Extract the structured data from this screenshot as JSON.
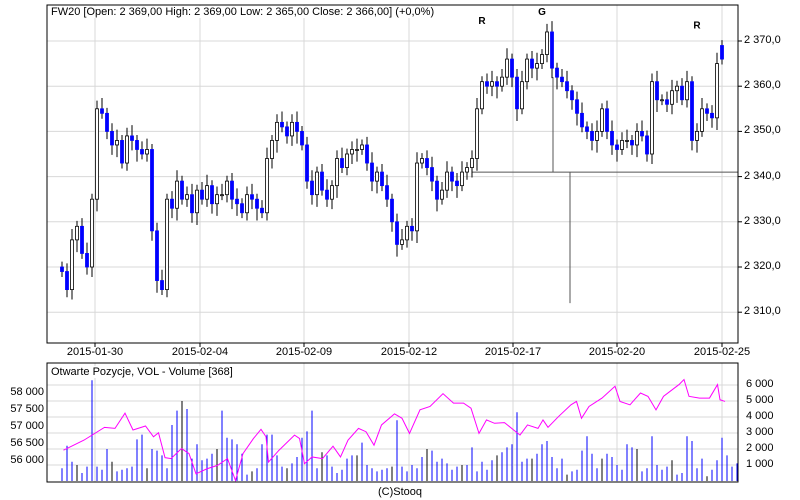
{
  "header": {
    "title": "FW20 [Open: 2 369,00  High: 2 369,00  Low: 2 365,00  Close: 2 366,00] (+0,0%)"
  },
  "volume_panel": {
    "title": "Otwarte Pozycje, VOL - Volume [368]"
  },
  "footer": {
    "credit": "(C)Stooq"
  },
  "colors": {
    "down": "#0000ff",
    "up": "#ffffff",
    "outline": "#000000",
    "oi_line": "#ff00ff",
    "grid": "#d8d8d8",
    "volume": "#0000ff"
  },
  "chart_data": [
    {
      "type": "candlestick",
      "title": "FW20",
      "ylim": [
        2308,
        2373
      ],
      "y_ticks": [
        "2 310,0",
        "2 320,0",
        "2 330,0",
        "2 340,0",
        "2 350,0",
        "2 360,0",
        "2 370,0"
      ],
      "y_tick_values": [
        2310,
        2320,
        2330,
        2340,
        2350,
        2360,
        2370
      ],
      "x_ticks": [
        "2015-01-30",
        "2015-02-04",
        "2015-02-09",
        "2015-02-12",
        "2015-02-17",
        "2015-02-20",
        "2015-02-25"
      ],
      "x_tick_bar_index": [
        6.6,
        27.6,
        48.4,
        69.4,
        90.2,
        111,
        132
      ],
      "grid": true,
      "closes": [
        2319,
        2315,
        2326,
        2329,
        2323,
        2320,
        2335,
        2355,
        2354,
        2350,
        2347,
        2348,
        2343,
        2349,
        2348,
        2346,
        2345,
        2346,
        2328,
        2317,
        2315,
        2335,
        2333,
        2339,
        2335,
        2336,
        2332,
        2337,
        2335,
        2338,
        2334,
        2336,
        2336,
        2339,
        2335,
        2334,
        2332,
        2336,
        2335,
        2333,
        2332,
        2344,
        2348,
        2352,
        2351,
        2349,
        2352,
        2350,
        2347,
        2339,
        2336,
        2341,
        2337,
        2335,
        2338,
        2344,
        2342,
        2345,
        2346,
        2346,
        2347,
        2343,
        2339,
        2341,
        2338,
        2335,
        2330,
        2325,
        2326,
        2329,
        2328,
        2343,
        2344,
        2342,
        2339,
        2335,
        2337,
        2341,
        2339,
        2338,
        2341,
        2342,
        2344,
        2355,
        2361,
        2360,
        2361,
        2360,
        2362,
        2366,
        2362,
        2355,
        2361,
        2366,
        2364,
        2365,
        2367,
        2372,
        2364,
        2362,
        2361,
        2359,
        2357,
        2354,
        2351,
        2350,
        2348,
        2350,
        2355,
        2350,
        2347,
        2346,
        2348,
        2348,
        2347,
        2350,
        2349,
        2345,
        2361,
        2357,
        2357,
        2356,
        2359,
        2360,
        2357,
        2361,
        2348,
        2350,
        2355,
        2354,
        2353,
        2365,
        2366
      ],
      "last_open": 2369,
      "annotations": [
        {
          "label": "R",
          "bar_index": 84,
          "price": 2372
        },
        {
          "label": "G",
          "bar_index": 96,
          "price": 2374
        },
        {
          "label": "R",
          "bar_index": 127,
          "price": 2371
        }
      ],
      "support_level": 2341,
      "support_from_bar_index": 82,
      "marker_lines": [
        {
          "bar_index": 98.2,
          "from": 2341,
          "to": 2362
        },
        {
          "bar_index": 101.6,
          "from": 2341,
          "to": 2312
        }
      ]
    },
    {
      "type": "bar+line",
      "title": "Otwarte Pozycje, VOL - Volume [368]",
      "volume_ylim": [
        0,
        6500
      ],
      "volume_ticks": [
        "1 000",
        "2 000",
        "3 000",
        "4 000",
        "5 000",
        "6 000"
      ],
      "volume_tick_values": [
        1000,
        2000,
        3000,
        4000,
        5000,
        6000
      ],
      "oi_ticks": [
        "56 000",
        "56 500",
        "57 000",
        "57 500",
        "58 000"
      ],
      "oi_tick_values": [
        56000,
        56500,
        57000,
        57500,
        58000
      ],
      "oi_ylim": [
        55400,
        58500
      ],
      "volume": [
        800,
        2200,
        1200,
        1000,
        500,
        900,
        6300,
        900,
        700,
        2000,
        1200,
        600,
        700,
        800,
        900,
        2600,
        2900,
        800,
        2000,
        1900,
        1600,
        800,
        3500,
        4400,
        5000,
        4500,
        1400,
        2300,
        1300,
        1400,
        1700,
        2000,
        4400,
        2700,
        2600,
        2300,
        1700,
        400,
        600,
        800,
        2300,
        2900,
        2900,
        1600,
        900,
        800,
        1100,
        1500,
        2700,
        3100,
        4400,
        800,
        1800,
        1600,
        900,
        500,
        700,
        1400,
        1600,
        1600,
        2400,
        1000,
        800,
        600,
        700,
        800,
        900,
        3800,
        900,
        600,
        1000,
        800,
        1500,
        2000,
        1900,
        1200,
        1400,
        1100,
        700,
        900,
        1000,
        1000,
        2100,
        600,
        1200,
        700,
        1300,
        1600,
        1800,
        2100,
        2300,
        4300,
        1200,
        1400,
        1400,
        1700,
        2300,
        2500,
        1500,
        800,
        1400,
        400,
        600,
        700,
        1900,
        2800,
        1700,
        800,
        1400,
        1700,
        1500,
        1000,
        700,
        2300,
        2100,
        2000,
        600,
        800,
        2800,
        1000,
        700,
        900,
        1300,
        400,
        500,
        2800,
        2500,
        800,
        1400,
        300,
        700,
        1300,
        2700,
        1600,
        900,
        1100
      ],
      "open_interest": [
        [
          0.3,
          56317
        ],
        [
          4.4,
          56614
        ],
        [
          8.5,
          56990
        ],
        [
          10.6,
          56960
        ],
        [
          12.6,
          57406
        ],
        [
          14.2,
          56911
        ],
        [
          16.7,
          57030
        ],
        [
          18.3,
          56713
        ],
        [
          19.3,
          56832
        ],
        [
          20.6,
          56099
        ],
        [
          21.8,
          56070
        ],
        [
          23.9,
          56366
        ],
        [
          25.4,
          56218
        ],
        [
          26.8,
          55624
        ],
        [
          29,
          55772
        ],
        [
          31.1,
          55871
        ],
        [
          33.1,
          56070
        ],
        [
          34.7,
          55426
        ],
        [
          36.2,
          56218
        ],
        [
          38.3,
          56663
        ],
        [
          39.8,
          56931
        ],
        [
          40.8,
          56713
        ],
        [
          41.3,
          55970
        ],
        [
          43.4,
          56317
        ],
        [
          46.5,
          56762
        ],
        [
          47.5,
          56663
        ],
        [
          48.5,
          55921
        ],
        [
          50,
          56119
        ],
        [
          52.1,
          56070
        ],
        [
          54.2,
          56436
        ],
        [
          55.7,
          56119
        ],
        [
          57.2,
          56614
        ],
        [
          59.3,
          56960
        ],
        [
          60.8,
          56861
        ],
        [
          62.4,
          56465
        ],
        [
          63.9,
          57060
        ],
        [
          66.5,
          57386
        ],
        [
          68,
          57257
        ],
        [
          69.5,
          56812
        ],
        [
          71.6,
          57505
        ],
        [
          73.6,
          57604
        ],
        [
          76.2,
          57980
        ],
        [
          78.3,
          57703
        ],
        [
          80.3,
          57703
        ],
        [
          81.8,
          57554
        ],
        [
          83.4,
          56812
        ],
        [
          84.9,
          57208
        ],
        [
          86.5,
          57109
        ],
        [
          88.5,
          57129
        ],
        [
          91.6,
          56762
        ],
        [
          93.1,
          57060
        ],
        [
          95.2,
          56960
        ],
        [
          96.2,
          57208
        ],
        [
          97.2,
          56990
        ],
        [
          99.3,
          57307
        ],
        [
          101.8,
          57653
        ],
        [
          102.9,
          57752
        ],
        [
          103.9,
          57257
        ],
        [
          105.4,
          57604
        ],
        [
          108,
          57851
        ],
        [
          110.6,
          58198
        ],
        [
          111.6,
          57752
        ],
        [
          113.6,
          57653
        ],
        [
          115.7,
          58000
        ],
        [
          117.2,
          57901
        ],
        [
          118.8,
          57505
        ],
        [
          120.3,
          57901
        ],
        [
          123.4,
          58248
        ],
        [
          124.4,
          58396
        ],
        [
          125.4,
          57901
        ],
        [
          127.5,
          57851
        ],
        [
          129.5,
          57851
        ],
        [
          131.1,
          58248
        ],
        [
          131.6,
          57802
        ],
        [
          132.6,
          57752
        ]
      ]
    }
  ]
}
